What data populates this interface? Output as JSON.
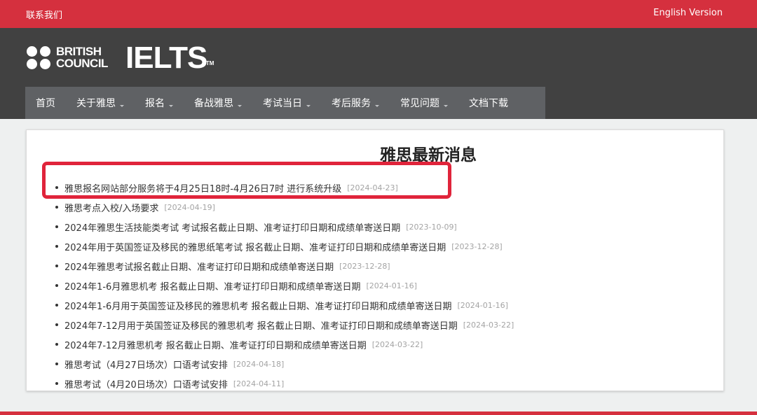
{
  "topbar": {
    "contact": "联系我们",
    "english": "English Version",
    "color": "#d5303e"
  },
  "logo": {
    "bc_line1": "BRITISH",
    "bc_line2": "COUNCIL",
    "ielts": "IELTS",
    "tm": "TM"
  },
  "nav": {
    "items": [
      {
        "label": "首页",
        "dropdown": false
      },
      {
        "label": "关于雅思",
        "dropdown": true
      },
      {
        "label": "报名",
        "dropdown": true
      },
      {
        "label": "备战雅思",
        "dropdown": true
      },
      {
        "label": "考试当日",
        "dropdown": true
      },
      {
        "label": "考后服务",
        "dropdown": true
      },
      {
        "label": "常见问题",
        "dropdown": true
      },
      {
        "label": "文档下载",
        "dropdown": false
      }
    ]
  },
  "main": {
    "title": "雅思最新消息",
    "news": [
      {
        "title": "雅思报名网站部分服务将于4月25日18时-4月26日7时 进行系统升级",
        "date": "[2024-04-23]"
      },
      {
        "title": "雅思考点入校/入场要求",
        "date": "[2024-04-19]"
      },
      {
        "title": "2024年雅思生活技能类考试 考试报名截止日期、准考证打印日期和成绩单寄送日期",
        "date": "[2023-10-09]"
      },
      {
        "title": "2024年用于英国签证及移民的雅思纸笔考试 报名截止日期、准考证打印日期和成绩单寄送日期",
        "date": "[2023-12-28]"
      },
      {
        "title": "2024年雅思考试报名截止日期、准考证打印日期和成绩单寄送日期",
        "date": "[2023-12-28]"
      },
      {
        "title": "2024年1-6月雅思机考 报名截止日期、准考证打印日期和成绩单寄送日期",
        "date": "[2024-01-16]"
      },
      {
        "title": "2024年1-6月用于英国签证及移民的雅思机考 报名截止日期、准考证打印日期和成绩单寄送日期",
        "date": "[2024-01-16]"
      },
      {
        "title": "2024年7-12月用于英国签证及移民的雅思机考 报名截止日期、准考证打印日期和成绩单寄送日期",
        "date": "[2024-03-22]"
      },
      {
        "title": "2024年7-12月雅思机考 报名截止日期、准考证打印日期和成绩单寄送日期",
        "date": "[2024-03-22]"
      },
      {
        "title": "雅思考试（4月27日场次）口语考试安排",
        "date": "[2024-04-18]"
      },
      {
        "title": "雅思考试（4月20日场次）口语考试安排",
        "date": "[2024-04-11]"
      }
    ]
  },
  "highlight_color": "#e0243b"
}
